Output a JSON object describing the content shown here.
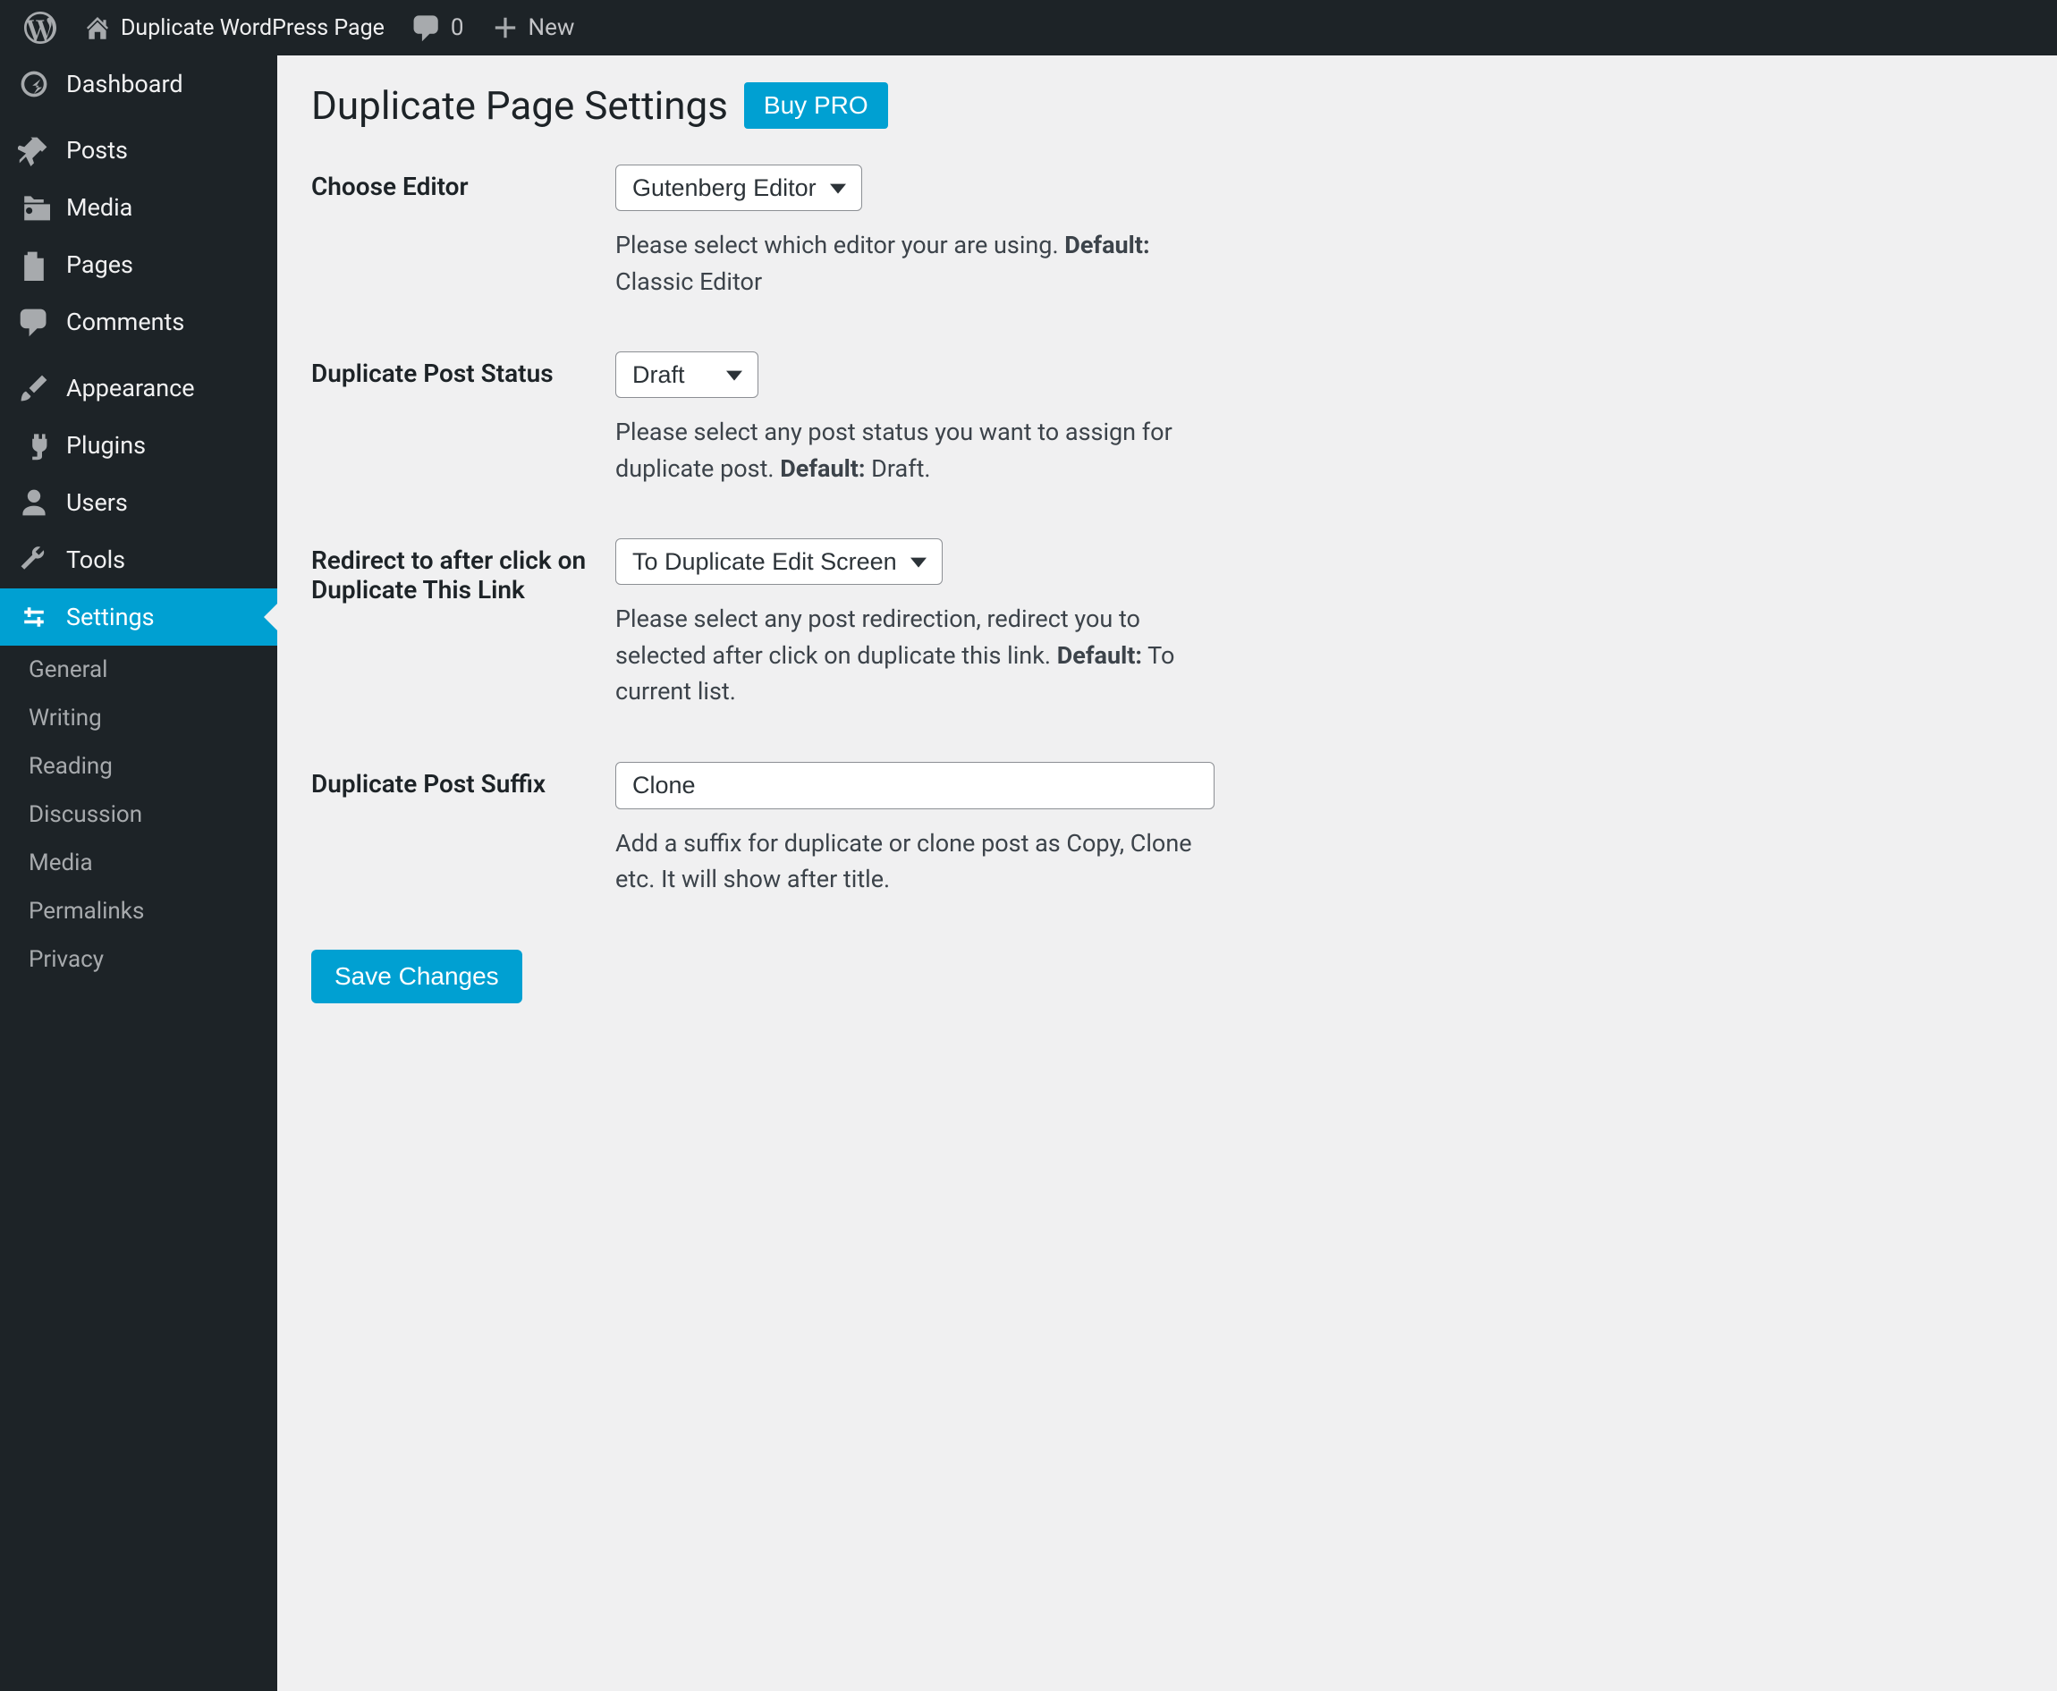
{
  "topbar": {
    "site_name": "Duplicate WordPress Page",
    "comments_count": "0",
    "new_label": "New"
  },
  "sidebar": {
    "items": [
      {
        "label": "Dashboard",
        "icon": "dashboard"
      },
      {
        "label": "Posts",
        "icon": "pin"
      },
      {
        "label": "Media",
        "icon": "media"
      },
      {
        "label": "Pages",
        "icon": "pages"
      },
      {
        "label": "Comments",
        "icon": "comments"
      },
      {
        "label": "Appearance",
        "icon": "appearance"
      },
      {
        "label": "Plugins",
        "icon": "plugins"
      },
      {
        "label": "Users",
        "icon": "users"
      },
      {
        "label": "Tools",
        "icon": "tools"
      },
      {
        "label": "Settings",
        "icon": "settings",
        "current": true
      }
    ],
    "submenu": [
      "General",
      "Writing",
      "Reading",
      "Discussion",
      "Media",
      "Permalinks",
      "Privacy"
    ]
  },
  "page": {
    "title": "Duplicate Page Settings",
    "buy_pro": "Buy PRO",
    "fields": {
      "editor_label": "Choose Editor",
      "editor_value": "Gutenberg Editor",
      "editor_help_1": "Please select which editor your are using. ",
      "editor_help_bold": "Default:",
      "editor_help_2": " Classic Editor",
      "status_label": "Duplicate Post Status",
      "status_value": "Draft",
      "status_help_1": "Please select any post status you want to assign for duplicate post. ",
      "status_help_bold": "Default:",
      "status_help_2": " Draft.",
      "redirect_label": "Redirect to after click on Duplicate This Link",
      "redirect_value": "To Duplicate Edit Screen",
      "redirect_help_1": "Please select any post redirection, redirect you to selected after click on duplicate this link. ",
      "redirect_help_bold": "Default:",
      "redirect_help_2": " To current list.",
      "suffix_label": "Duplicate Post Suffix",
      "suffix_value": "Clone",
      "suffix_help": "Add a suffix for duplicate or clone post as Copy, Clone etc. It will show after title."
    },
    "save_label": "Save Changes"
  }
}
